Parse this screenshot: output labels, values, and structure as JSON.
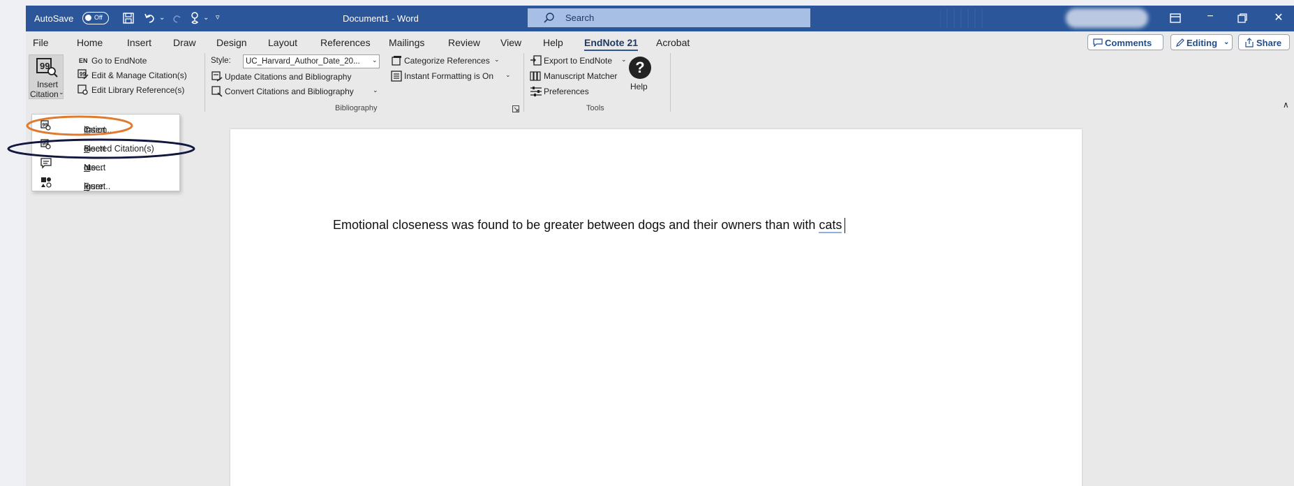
{
  "titlebar": {
    "autosave_label": "AutoSave",
    "autosave_state": "Off",
    "document_title": "Document1  -  Word",
    "search_placeholder": "Search"
  },
  "menu": {
    "tabs": [
      "File",
      "Home",
      "Insert",
      "Draw",
      "Design",
      "Layout",
      "References",
      "Mailings",
      "Review",
      "View",
      "Help",
      "EndNote 21",
      "Acrobat"
    ],
    "active_tab": "EndNote 21",
    "comments_label": "Comments",
    "editing_label": "Editing",
    "share_label": "Share"
  },
  "ribbon": {
    "insert_citation_line1": "Insert",
    "insert_citation_line2": "Citation",
    "go_to_endnote_badge": "EN",
    "go_to_endnote": "Go to EndNote",
    "edit_manage": "Edit & Manage Citation(s)",
    "edit_library": "Edit Library Reference(s)",
    "style_label": "Style:",
    "style_value": "UC_Harvard_Author_Date_20...",
    "update_citations": "Update Citations and Bibliography",
    "convert_citations": "Convert Citations and Bibliography",
    "categorize_references": "Categorize References",
    "instant_formatting": "Instant Formatting is On",
    "bibliography_group": "Bibliography",
    "export_to_endnote": "Export to EndNote",
    "manuscript_matcher": "Manuscript Matcher",
    "preferences": "Preferences",
    "help": "Help",
    "tools_group": "Tools"
  },
  "dropdown": {
    "items": [
      {
        "prefix": "Insert ",
        "key": "C",
        "suffix": "itation..."
      },
      {
        "prefix": "Insert ",
        "key": "S",
        "suffix": "elected Citation(s)"
      },
      {
        "prefix": "Insert ",
        "key": "N",
        "suffix": "ote..."
      },
      {
        "prefix": "Insert ",
        "key": "F",
        "suffix": "igure..."
      }
    ]
  },
  "document": {
    "text_before": "Emotional closeness was found to be greater between dogs and their owners than with ",
    "text_last_word": "cats"
  },
  "colors": {
    "title_bar": "#2b579a",
    "orange_highlight": "#e07a2e",
    "navy_highlight": "#12173e"
  }
}
